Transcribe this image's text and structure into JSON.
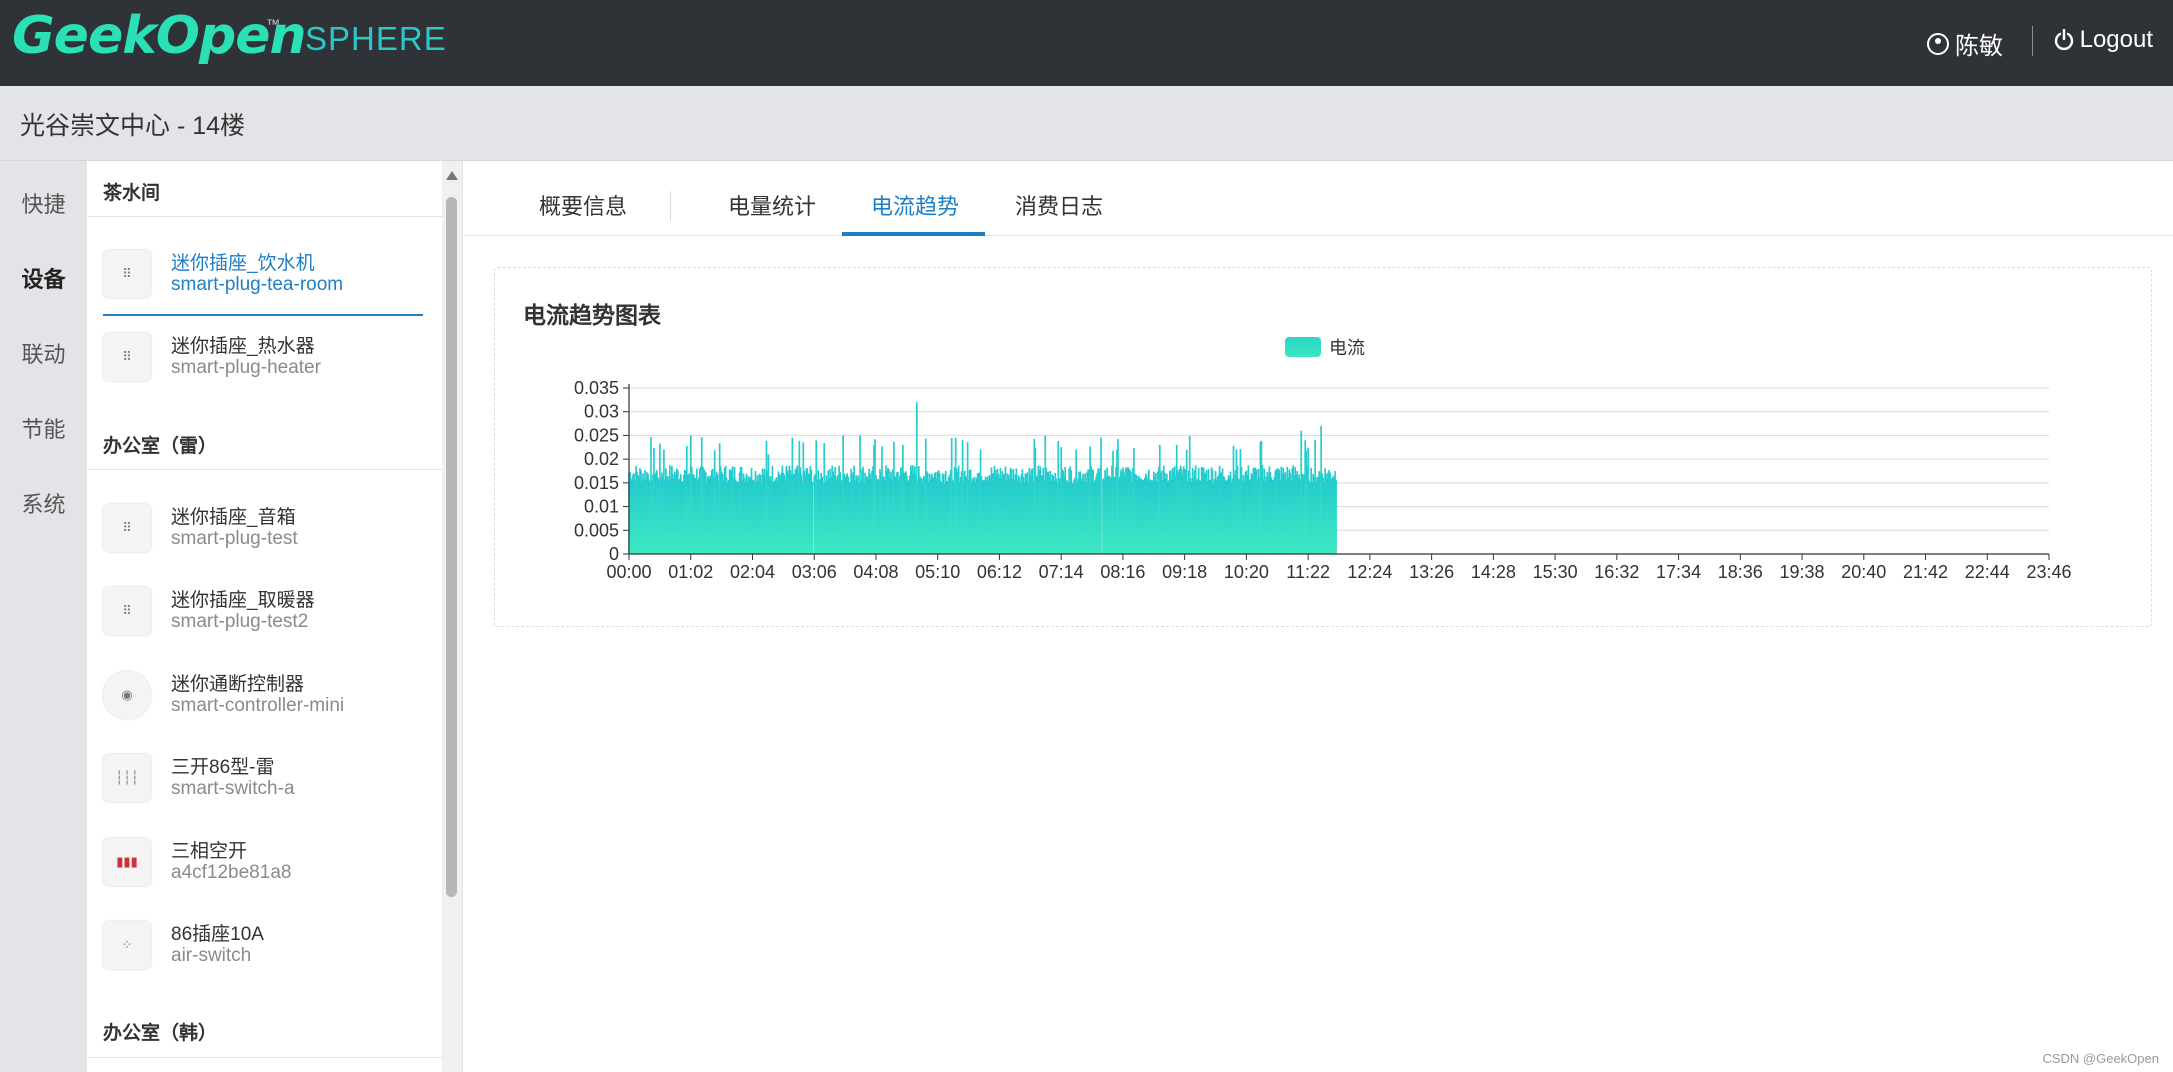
{
  "header": {
    "brand": "GeekOpen",
    "trademark": "™",
    "product": "SPHERE",
    "user_name": "陈敏",
    "logout_label": "Logout"
  },
  "location": {
    "title": "光谷崇文中心 - 14楼"
  },
  "left_nav": {
    "items": [
      {
        "label": "快捷"
      },
      {
        "label": "设备"
      },
      {
        "label": "联动"
      },
      {
        "label": "节能"
      },
      {
        "label": "系统"
      }
    ]
  },
  "device_groups": [
    {
      "title": "茶水间",
      "devices": [
        {
          "name": "迷你插座_饮水机",
          "id": "smart-plug-tea-room",
          "icon": "plug-icon",
          "selected": true
        },
        {
          "name": "迷你插座_热水器",
          "id": "smart-plug-heater",
          "icon": "plug-icon"
        }
      ]
    },
    {
      "title": "办公室（雷）",
      "devices": [
        {
          "name": "迷你插座_音箱",
          "id": "smart-plug-test",
          "icon": "plug-icon"
        },
        {
          "name": "迷你插座_取暖器",
          "id": "smart-plug-test2",
          "icon": "plug-icon"
        },
        {
          "name": "迷你通断控制器",
          "id": "smart-controller-mini",
          "icon": "controller-icon"
        },
        {
          "name": "三开86型-雷",
          "id": "smart-switch-a",
          "icon": "switch-icon"
        },
        {
          "name": "三相空开",
          "id": "a4cf12be81a8",
          "icon": "breaker-icon"
        },
        {
          "name": "86插座10A",
          "id": "air-switch",
          "icon": "socket-icon"
        }
      ]
    },
    {
      "title": "办公室（韩）",
      "devices": []
    }
  ],
  "tabs": [
    {
      "label": "概要信息"
    },
    {
      "label": "电量统计"
    },
    {
      "label": "电流趋势",
      "active": true
    },
    {
      "label": "消费日志"
    }
  ],
  "chart_card": {
    "title": "电流趋势图表"
  },
  "chart_data": {
    "type": "bar",
    "title": "",
    "legend": [
      "电流"
    ],
    "series": [
      {
        "name": "电流",
        "color": "#2fd9c6"
      }
    ],
    "ylim": [
      0,
      0.035
    ],
    "yticks": [
      "0",
      "0.005",
      "0.01",
      "0.015",
      "0.02",
      "0.025",
      "0.03",
      "0.035"
    ],
    "xlim": [
      "00:00",
      "23:46"
    ],
    "xticks": [
      "00:00",
      "01:02",
      "02:04",
      "03:06",
      "04:08",
      "05:10",
      "06:12",
      "07:14",
      "08:16",
      "09:18",
      "10:20",
      "11:22",
      "12:24",
      "13:26",
      "14:28",
      "15:30",
      "16:32",
      "17:34",
      "18:36",
      "19:38",
      "20:40",
      "21:42",
      "22:44",
      "23:46"
    ],
    "data_range": [
      "00:00",
      "11:50"
    ],
    "typical_value": 0.017,
    "peak_values": [
      {
        "x": "00:35",
        "y": 0.022
      },
      {
        "x": "01:02",
        "y": 0.025
      },
      {
        "x": "02:20",
        "y": 0.021
      },
      {
        "x": "03:35",
        "y": 0.025
      },
      {
        "x": "03:52",
        "y": 0.025
      },
      {
        "x": "04:35",
        "y": 0.023
      },
      {
        "x": "04:49",
        "y": 0.032
      },
      {
        "x": "05:35",
        "y": 0.024
      },
      {
        "x": "06:58",
        "y": 0.025
      },
      {
        "x": "08:10",
        "y": 0.022
      },
      {
        "x": "09:10",
        "y": 0.023
      },
      {
        "x": "10:10",
        "y": 0.022
      },
      {
        "x": "11:15",
        "y": 0.026
      },
      {
        "x": "11:35",
        "y": 0.027
      }
    ],
    "gap_at": [
      "03:05",
      "07:55"
    ]
  },
  "watermark": "CSDN @GeekOpen"
}
